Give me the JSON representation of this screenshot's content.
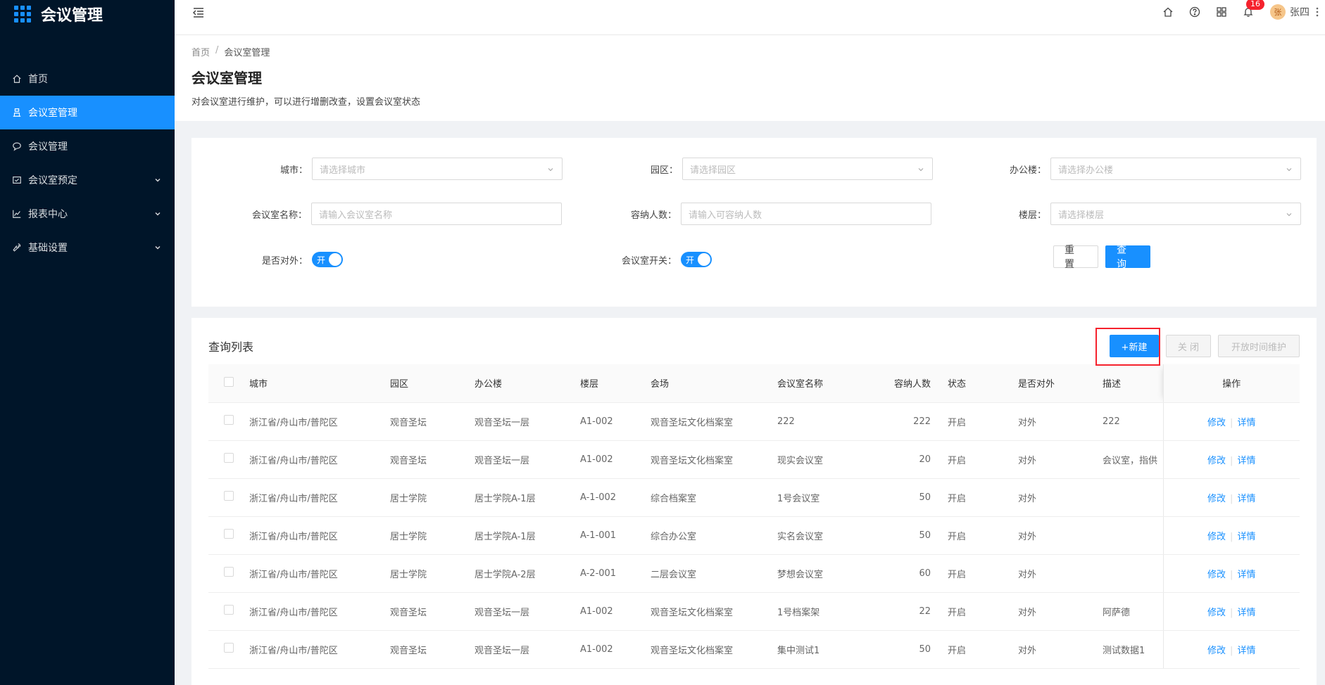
{
  "app": {
    "title": "会议管理"
  },
  "sidebar": {
    "items": [
      {
        "label": "首页",
        "icon": "home-icon"
      },
      {
        "label": "会议室管理",
        "icon": "room-icon",
        "active": true
      },
      {
        "label": "会议管理",
        "icon": "chat-icon"
      },
      {
        "label": "会议室预定",
        "icon": "booking-icon",
        "expandable": true
      },
      {
        "label": "报表中心",
        "icon": "chart-icon",
        "expandable": true
      },
      {
        "label": "基础设置",
        "icon": "wrench-icon",
        "expandable": true
      }
    ]
  },
  "header": {
    "notification_count": "16",
    "avatar_text": "张",
    "username": "张四"
  },
  "breadcrumb": {
    "home": "首页",
    "sep": "/",
    "current": "会议室管理"
  },
  "page": {
    "title": "会议室管理",
    "description": "对会议室进行维护，可以进行增删改查，设置会议室状态"
  },
  "search": {
    "city": {
      "label": "城市：",
      "placeholder": "请选择城市"
    },
    "park": {
      "label": "园区：",
      "placeholder": "请选择园区"
    },
    "building": {
      "label": "办公楼：",
      "placeholder": "请选择办公楼"
    },
    "room_name": {
      "label": "会议室名称：",
      "placeholder": "请输入会议室名称"
    },
    "capacity": {
      "label": "容纳人数：",
      "placeholder": "请输入可容纳人数"
    },
    "floor": {
      "label": "楼层：",
      "placeholder": "请选择楼层"
    },
    "external": {
      "label": "是否对外：",
      "switch_text": "开"
    },
    "room_switch": {
      "label": "会议室开关：",
      "switch_text": "开"
    },
    "reset_label": "重 置",
    "query_label": "查 询"
  },
  "list": {
    "title": "查询列表",
    "new_label": "+新建",
    "close_label": "关 闭",
    "open_time_label": "开放时间维护",
    "columns": [
      "城市",
      "园区",
      "办公楼",
      "楼层",
      "会场",
      "会议室名称",
      "容纳人数",
      "状态",
      "是否对外",
      "描述",
      "操作"
    ],
    "edit_label": "修改",
    "detail_label": "详情",
    "rows": [
      {
        "city": "浙江省/舟山市/普陀区",
        "park": "观音圣坛",
        "building": "观音圣坛一层",
        "floor": "A1-002",
        "venue": "观音圣坛文化档案室",
        "name": "222",
        "capacity": "222",
        "status": "开启",
        "external": "对外",
        "desc": "222"
      },
      {
        "city": "浙江省/舟山市/普陀区",
        "park": "观音圣坛",
        "building": "观音圣坛一层",
        "floor": "A1-002",
        "venue": "观音圣坛文化档案室",
        "name": "现实会议室",
        "capacity": "20",
        "status": "开启",
        "external": "对外",
        "desc": "会议室，指供"
      },
      {
        "city": "浙江省/舟山市/普陀区",
        "park": "居士学院",
        "building": "居士学院A-1层",
        "floor": "A-1-002",
        "venue": "综合档案室",
        "name": "1号会议室",
        "capacity": "50",
        "status": "开启",
        "external": "对外",
        "desc": ""
      },
      {
        "city": "浙江省/舟山市/普陀区",
        "park": "居士学院",
        "building": "居士学院A-1层",
        "floor": "A-1-001",
        "venue": "综合办公室",
        "name": "实名会议室",
        "capacity": "50",
        "status": "开启",
        "external": "对外",
        "desc": ""
      },
      {
        "city": "浙江省/舟山市/普陀区",
        "park": "居士学院",
        "building": "居士学院A-2层",
        "floor": "A-2-001",
        "venue": "二层会议室",
        "name": "梦想会议室",
        "capacity": "60",
        "status": "开启",
        "external": "对外",
        "desc": ""
      },
      {
        "city": "浙江省/舟山市/普陀区",
        "park": "观音圣坛",
        "building": "观音圣坛一层",
        "floor": "A1-002",
        "venue": "观音圣坛文化档案室",
        "name": "1号档案架",
        "capacity": "22",
        "status": "开启",
        "external": "对外",
        "desc": "阿萨德"
      },
      {
        "city": "浙江省/舟山市/普陀区",
        "park": "观音圣坛",
        "building": "观音圣坛一层",
        "floor": "A1-002",
        "venue": "观音圣坛文化档案室",
        "name": "集中测试1",
        "capacity": "50",
        "status": "开启",
        "external": "对外",
        "desc": "测试数据1"
      }
    ]
  },
  "colors": {
    "primary": "#1890ff",
    "sidebar_bg": "#001529",
    "highlight": "#f5222d"
  }
}
